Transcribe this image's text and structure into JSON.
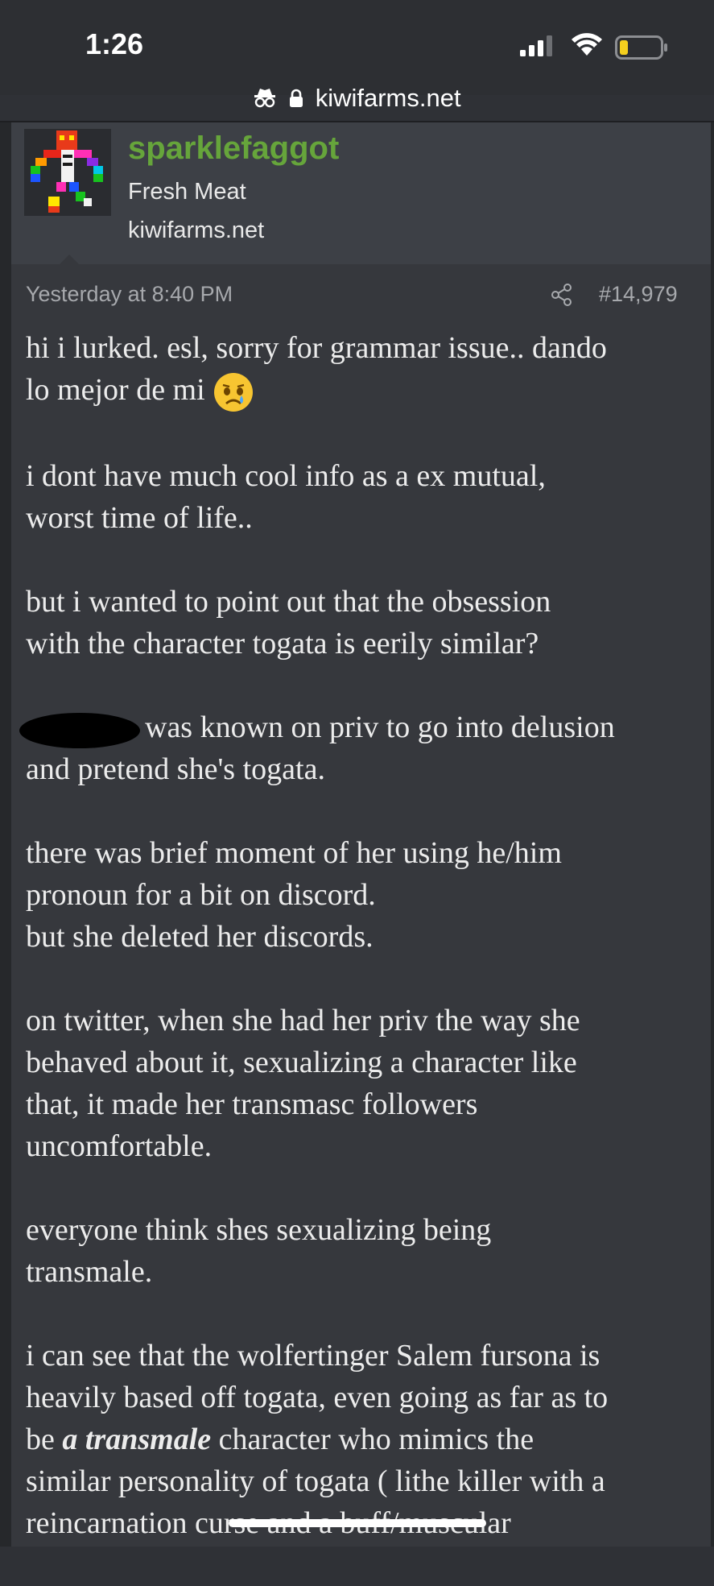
{
  "status_bar": {
    "time": "1:26",
    "url": "kiwifarms.net",
    "icons": [
      "signal-icon",
      "wifi-icon",
      "battery-icon",
      "incognito-icon",
      "lock-icon"
    ]
  },
  "user": {
    "name": "sparklefaggot",
    "title": "Fresh Meat",
    "site": "kiwifarms.net",
    "name_color": "#66a53b"
  },
  "post": {
    "date": "Yesterday at 8:40 PM",
    "number": "#14,979",
    "lines": {
      "p1_l1": "hi i lurked. esl, sorry for grammar issue.. dando",
      "p1_l2": "lo mejor de mi",
      "p2_l1": "i dont have much cool info as a ex mutual,",
      "p2_l2": "worst time of life..",
      "p3_l1": "but i wanted to point out that the obsession",
      "p3_l2": "with the character togata is eerily similar?",
      "p4_l1": "was known on priv to go into delusion",
      "p4_l2": "and pretend she's togata.",
      "p5_l1": "there was brief moment of her using he/him",
      "p5_l2": "pronoun for a bit on discord.",
      "p5_l3": "but she deleted her discords.",
      "p6_l1": "on twitter, when she had her priv the way she",
      "p6_l2": "behaved about it, sexualizing a character like",
      "p6_l3": "that, it made her transmasc followers",
      "p6_l4": "uncomfortable.",
      "p7_l1": "everyone think shes sexualizing being",
      "p7_l2": "transmale.",
      "p8_l1": "i can see that the wolfertinger Salem fursona is",
      "p8_l2": "heavily based off togata, even going as far as to",
      "p8_l3a": "be ",
      "p8_l3b": "a transmale",
      "p8_l3c": " character who mimics the",
      "p8_l4": "similar personality of togata ( lithe killer with a",
      "p8_l5": "reincarnation curse and a buff/muscular"
    }
  },
  "colors": {
    "background": "#2f3136",
    "header_bg": "#3d4046",
    "post_bg": "#36383d",
    "meta_text": "#a7a9ad"
  }
}
